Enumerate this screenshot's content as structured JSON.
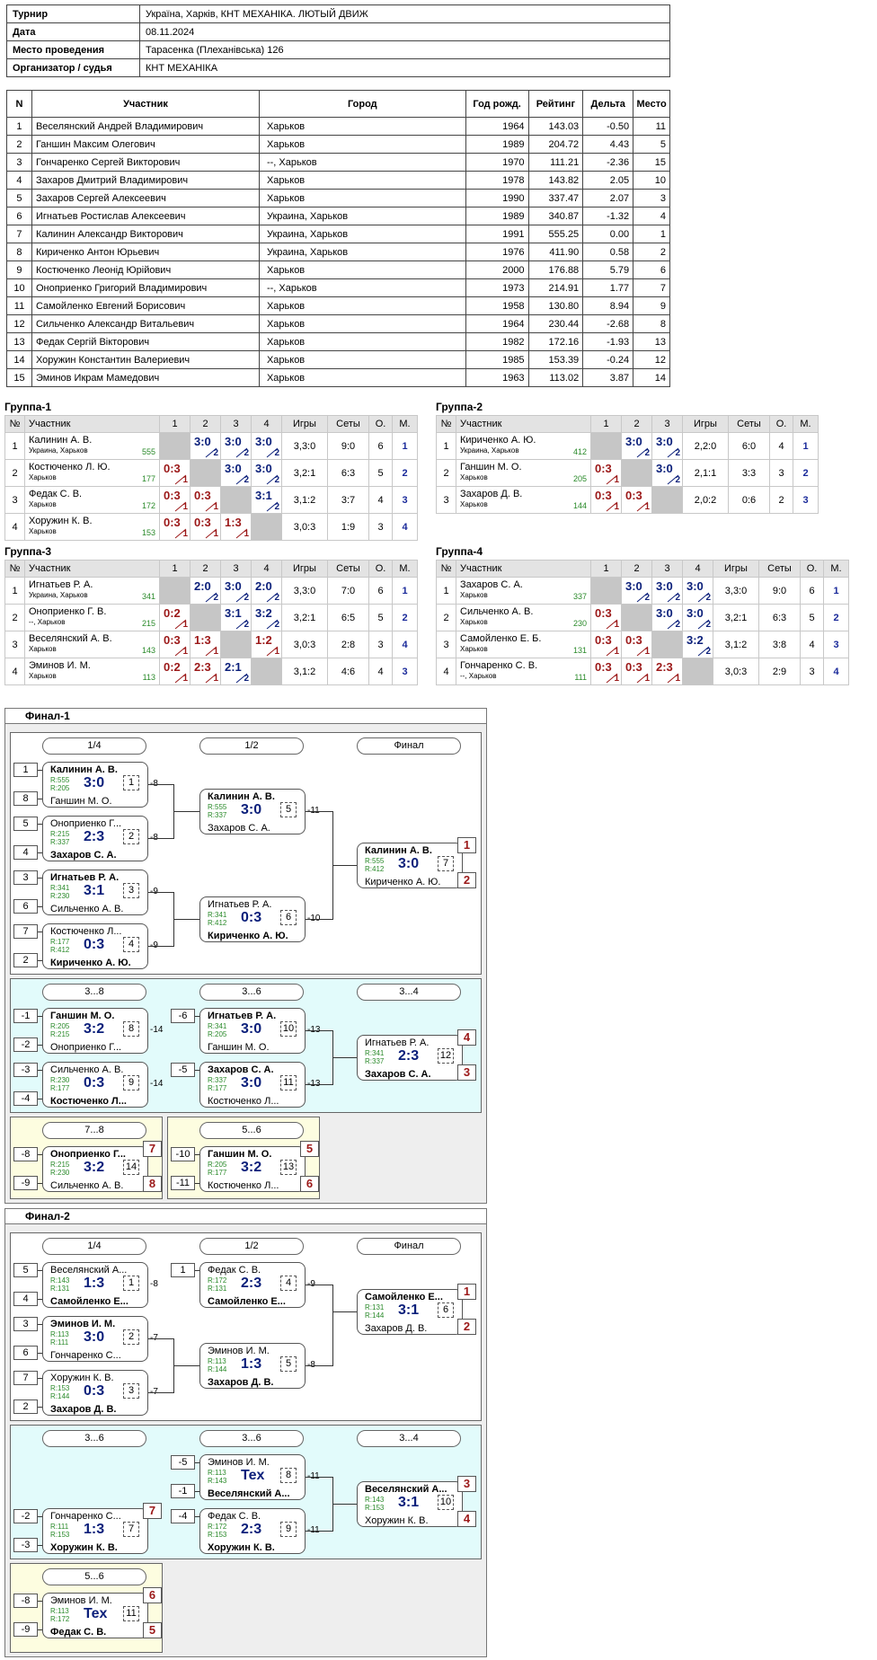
{
  "info": [
    {
      "k": "Турнир",
      "v": "Україна, Харків, КНТ МЕХАНІКА. ЛЮТЫЙ ДВИЖ"
    },
    {
      "k": "Дата",
      "v": "08.11.2024"
    },
    {
      "k": "Место проведения",
      "v": "Тарасенка (Плеханівська) 126"
    },
    {
      "k": "Организатор / судья",
      "v": "КНТ МЕХАНІКА"
    }
  ],
  "players_header": [
    "N",
    "Участник",
    "Город",
    "Год рожд.",
    "Рейтинг",
    "Дельта",
    "Место"
  ],
  "players": [
    [
      "1",
      "Веселянский Андрей Владимирович",
      "Харьков",
      "1964",
      "143.03",
      "-0.50",
      "11"
    ],
    [
      "2",
      "Ганшин Максим Олегович",
      "Харьков",
      "1989",
      "204.72",
      "4.43",
      "5"
    ],
    [
      "3",
      "Гончаренко Сергей Викторович",
      "--, Харьков",
      "1970",
      "111.21",
      "-2.36",
      "15"
    ],
    [
      "4",
      "Захаров Дмитрий Владимирович",
      "Харьков",
      "1978",
      "143.82",
      "2.05",
      "10"
    ],
    [
      "5",
      "Захаров Сергей Алексеевич",
      "Харьков",
      "1990",
      "337.47",
      "2.07",
      "3"
    ],
    [
      "6",
      "Игнатьев Ростислав Алексеевич",
      "Украина, Харьков",
      "1989",
      "340.87",
      "-1.32",
      "4"
    ],
    [
      "7",
      "Калинин Александр Викторович",
      "Украина, Харьков",
      "1991",
      "555.25",
      "0.00",
      "1"
    ],
    [
      "8",
      "Кириченко Антон Юрьевич",
      "Украина, Харьков",
      "1976",
      "411.90",
      "0.58",
      "2"
    ],
    [
      "9",
      "Костюченко Леонід Юрійович",
      "Харьков",
      "2000",
      "176.88",
      "5.79",
      "6"
    ],
    [
      "10",
      "Оноприенко Григорий Владимирович",
      "--, Харьков",
      "1973",
      "214.91",
      "1.77",
      "7"
    ],
    [
      "11",
      "Самойленко Евгений Борисович",
      "Харьков",
      "1958",
      "130.80",
      "8.94",
      "9"
    ],
    [
      "12",
      "Сильченко Александр Витальевич",
      "Харьков",
      "1964",
      "230.44",
      "-2.68",
      "8"
    ],
    [
      "13",
      "Федак Сергій Вікторович",
      "Харьков",
      "1982",
      "172.16",
      "-1.93",
      "13"
    ],
    [
      "14",
      "Хоружин Константин Валериевич",
      "Харьков",
      "1985",
      "153.39",
      "-0.24",
      "12"
    ],
    [
      "15",
      "Эминов Икрам Мамедович",
      "Харьков",
      "1963",
      "113.02",
      "3.87",
      "14"
    ]
  ],
  "group_header": {
    "n": "№",
    "participant": "Участник",
    "games": "Игры",
    "sets": "Сеты",
    "points": "О.",
    "place": "М."
  },
  "groups": [
    {
      "title": "Группа-1",
      "cols": [
        "1",
        "2",
        "3",
        "4"
      ],
      "rows": [
        {
          "n": "1",
          "name": "Калинин А. В.",
          "city": "Украина, Харьков",
          "rating": "555",
          "cells": [
            "",
            "3:0|2",
            "3:0|2",
            "3:0|2"
          ],
          "games": "3,3:0",
          "sets": "9:0",
          "pts": "6",
          "place": "1"
        },
        {
          "n": "2",
          "name": "Костюченко Л. Ю.",
          "city": "Харьков",
          "rating": "177",
          "cells": [
            "0:3|1",
            "",
            "3:0|2",
            "3:0|2"
          ],
          "games": "3,2:1",
          "sets": "6:3",
          "pts": "5",
          "place": "2"
        },
        {
          "n": "3",
          "name": "Федак С. В.",
          "city": "Харьков",
          "rating": "172",
          "cells": [
            "0:3|1",
            "0:3|1",
            "",
            "3:1|2"
          ],
          "games": "3,1:2",
          "sets": "3:7",
          "pts": "4",
          "place": "3"
        },
        {
          "n": "4",
          "name": "Хоружин К. В.",
          "city": "Харьков",
          "rating": "153",
          "cells": [
            "0:3|1",
            "0:3|1",
            "1:3|1",
            ""
          ],
          "games": "3,0:3",
          "sets": "1:9",
          "pts": "3",
          "place": "4"
        }
      ]
    },
    {
      "title": "Группа-2",
      "cols": [
        "1",
        "2",
        "3"
      ],
      "rows": [
        {
          "n": "1",
          "name": "Кириченко А. Ю.",
          "city": "Украина, Харьков",
          "rating": "412",
          "cells": [
            "",
            "3:0|2",
            "3:0|2"
          ],
          "games": "2,2:0",
          "sets": "6:0",
          "pts": "4",
          "place": "1"
        },
        {
          "n": "2",
          "name": "Ганшин М. О.",
          "city": "Харьков",
          "rating": "205",
          "cells": [
            "0:3|1",
            "",
            "3:0|2"
          ],
          "games": "2,1:1",
          "sets": "3:3",
          "pts": "3",
          "place": "2"
        },
        {
          "n": "3",
          "name": "Захаров Д. В.",
          "city": "Харьков",
          "rating": "144",
          "cells": [
            "0:3|1",
            "0:3|1",
            ""
          ],
          "games": "2,0:2",
          "sets": "0:6",
          "pts": "2",
          "place": "3"
        }
      ]
    },
    {
      "title": "Группа-3",
      "cols": [
        "1",
        "2",
        "3",
        "4"
      ],
      "rows": [
        {
          "n": "1",
          "name": "Игнатьев Р. А.",
          "city": "Украина, Харьков",
          "rating": "341",
          "cells": [
            "",
            "2:0|2",
            "3:0|2",
            "2:0|2"
          ],
          "games": "3,3:0",
          "sets": "7:0",
          "pts": "6",
          "place": "1"
        },
        {
          "n": "2",
          "name": "Оноприенко Г. В.",
          "city": "--, Харьков",
          "rating": "215",
          "cells": [
            "0:2|1",
            "",
            "3:1|2",
            "3:2|2"
          ],
          "games": "3,2:1",
          "sets": "6:5",
          "pts": "5",
          "place": "2"
        },
        {
          "n": "3",
          "name": "Веселянский А. В.",
          "city": "Харьков",
          "rating": "143",
          "cells": [
            "0:3|1",
            "1:3|1",
            "",
            "1:2|1"
          ],
          "games": "3,0:3",
          "sets": "2:8",
          "pts": "3",
          "place": "4"
        },
        {
          "n": "4",
          "name": "Эминов И. М.",
          "city": "Харьков",
          "rating": "113",
          "cells": [
            "0:2|1",
            "2:3|1",
            "2:1|2",
            ""
          ],
          "games": "3,1:2",
          "sets": "4:6",
          "pts": "4",
          "place": "3"
        }
      ]
    },
    {
      "title": "Группа-4",
      "cols": [
        "1",
        "2",
        "3",
        "4"
      ],
      "rows": [
        {
          "n": "1",
          "name": "Захаров С. А.",
          "city": "Харьков",
          "rating": "337",
          "cells": [
            "",
            "3:0|2",
            "3:0|2",
            "3:0|2"
          ],
          "games": "3,3:0",
          "sets": "9:0",
          "pts": "6",
          "place": "1"
        },
        {
          "n": "2",
          "name": "Сильченко А. В.",
          "city": "Харьков",
          "rating": "230",
          "cells": [
            "0:3|1",
            "",
            "3:0|2",
            "3:0|2"
          ],
          "games": "3,2:1",
          "sets": "6:3",
          "pts": "5",
          "place": "2"
        },
        {
          "n": "3",
          "name": "Самойленко Е. Б.",
          "city": "Харьков",
          "rating": "131",
          "cells": [
            "0:3|1",
            "0:3|1",
            "",
            "3:2|2"
          ],
          "games": "3,1:2",
          "sets": "3:8",
          "pts": "4",
          "place": "3"
        },
        {
          "n": "4",
          "name": "Гончаренко С. В.",
          "city": "--, Харьков",
          "rating": "111",
          "cells": [
            "0:3|1",
            "0:3|1",
            "2:3|1",
            ""
          ],
          "games": "3,0:3",
          "sets": "2:9",
          "pts": "3",
          "place": "4"
        }
      ]
    }
  ],
  "finals": [
    {
      "title": "Финал-1",
      "sections": [
        {
          "bg": "#ffffff",
          "pills": [
            "1/4",
            "1/2",
            "Финал"
          ]
        },
        {
          "bg": "#e2fbfb",
          "pills": [
            "3...8",
            "3...6",
            "3...4"
          ]
        },
        {
          "bg": "#fdfde0",
          "pills": [
            "7...8"
          ]
        },
        {
          "bg": "#fdfde0",
          "pills": [
            "5...6"
          ]
        }
      ],
      "matches": [
        {
          "p1": "Калинин А. В.",
          "r1": "R:555",
          "p2": "Ганшин М. О.",
          "r2": "R:205",
          "score": "3:0",
          "num": "1",
          "w": 1,
          "seeds": [
            "1",
            "8"
          ],
          "loser": "-8"
        },
        {
          "p1": "Оноприенко Г...",
          "r1": "R:215",
          "p2": "Захаров С. А.",
          "r2": "R:337",
          "score": "2:3",
          "num": "2",
          "w": 2,
          "seeds": [
            "5",
            "4"
          ],
          "loser": "-8"
        },
        {
          "p1": "Игнатьев Р. А.",
          "r1": "R:341",
          "p2": "Сильченко А. В.",
          "r2": "R:230",
          "score": "3:1",
          "num": "3",
          "w": 1,
          "seeds": [
            "3",
            "6"
          ],
          "loser": "-9"
        },
        {
          "p1": "Костюченко Л...",
          "r1": "R:177",
          "p2": "Кириченко А. Ю.",
          "r2": "R:412",
          "score": "0:3",
          "num": "4",
          "w": 2,
          "seeds": [
            "7",
            "2"
          ],
          "loser": "-9"
        },
        {
          "p1": "Калинин А. В.",
          "r1": "R:555",
          "p2": "Захаров С. А.",
          "r2": "R:337",
          "score": "3:0",
          "num": "5",
          "w": 1,
          "loser": "-11"
        },
        {
          "p1": "Игнатьев Р. А.",
          "r1": "R:341",
          "p2": "Кириченко А. Ю.",
          "r2": "R:412",
          "score": "0:3",
          "num": "6",
          "w": 2,
          "loser": "-10"
        },
        {
          "p1": "Калинин А. В.",
          "r1": "R:555",
          "p2": "Кириченко А. Ю.",
          "r2": "R:412",
          "score": "3:0",
          "num": "7",
          "w": 1,
          "places": [
            "1",
            "2"
          ]
        },
        {
          "p1": "Ганшин М. О.",
          "r1": "R:205",
          "p2": "Оноприенко Г...",
          "r2": "R:215",
          "score": "3:2",
          "num": "8",
          "w": 1,
          "seeds": [
            "-1",
            "-2"
          ],
          "loser": "-14"
        },
        {
          "p1": "Сильченко А. В.",
          "r1": "R:230",
          "p2": "Костюченко Л...",
          "r2": "R:177",
          "score": "0:3",
          "num": "9",
          "w": 2,
          "seeds": [
            "-3",
            "-4"
          ],
          "loser": "-14"
        },
        {
          "p1": "Игнатьев Р. А.",
          "r1": "R:341",
          "p2": "Ганшин М. О.",
          "r2": "R:205",
          "score": "3:0",
          "num": "10",
          "w": 1,
          "seeds": [
            "-6"
          ],
          "loser": "-13"
        },
        {
          "p1": "Захаров С. А.",
          "r1": "R:337",
          "p2": "Костюченко Л...",
          "r2": "R:177",
          "score": "3:0",
          "num": "11",
          "w": 1,
          "seeds": [
            "-5"
          ],
          "loser": "-13"
        },
        {
          "p1": "Игнатьев Р. А.",
          "r1": "R:341",
          "p2": "Захаров С. А.",
          "r2": "R:337",
          "score": "2:3",
          "num": "12",
          "w": 2,
          "places": [
            "4",
            "3"
          ]
        },
        {
          "p1": "Оноприенко Г...",
          "r1": "R:215",
          "p2": "Сильченко А. В.",
          "r2": "R:230",
          "score": "3:2",
          "num": "14",
          "w": 1,
          "seeds": [
            "-8",
            "-9"
          ],
          "places": [
            "7",
            "8"
          ]
        },
        {
          "p1": "Ганшин М. О.",
          "r1": "R:205",
          "p2": "Костюченко Л...",
          "r2": "R:177",
          "score": "3:2",
          "num": "13",
          "w": 1,
          "seeds": [
            "-10",
            "-11"
          ],
          "places": [
            "5",
            "6"
          ]
        }
      ]
    },
    {
      "title": "Финал-2",
      "sections": [
        {
          "bg": "#ffffff",
          "pills": [
            "1/4",
            "1/2",
            "Финал"
          ]
        },
        {
          "bg": "#e2fbfb",
          "pills": [
            "3...6",
            "3...6",
            "3...4"
          ]
        },
        {
          "bg": "#fdfde0",
          "pills": [
            "5...6"
          ]
        }
      ],
      "matches": [
        {
          "p1": "Веселянский А...",
          "r1": "R:143",
          "p2": "Самойленко Е...",
          "r2": "R:131",
          "score": "1:3",
          "num": "1",
          "w": 2,
          "seeds": [
            "5",
            "4"
          ],
          "loser": "-8"
        },
        {
          "p1": "Эминов И. М.",
          "r1": "R:113",
          "p2": "Гончаренко С...",
          "r2": "R:111",
          "score": "3:0",
          "num": "2",
          "w": 1,
          "seeds": [
            "3",
            "6"
          ],
          "loser": "-7"
        },
        {
          "p1": "Хоружин К. В.",
          "r1": "R:153",
          "p2": "Захаров Д. В.",
          "r2": "R:144",
          "score": "0:3",
          "num": "3",
          "w": 2,
          "seeds": [
            "7",
            "2"
          ],
          "loser": "-7"
        },
        {
          "p1": "Федак С. В.",
          "r1": "R:172",
          "p2": "Самойленко Е...",
          "r2": "R:131",
          "score": "2:3",
          "num": "4",
          "w": 2,
          "seeds": [
            "1"
          ],
          "loser": "-9"
        },
        {
          "p1": "Эминов И. М.",
          "r1": "R:113",
          "p2": "Захаров Д. В.",
          "r2": "R:144",
          "score": "1:3",
          "num": "5",
          "w": 2,
          "loser": "-8"
        },
        {
          "p1": "Самойленко Е...",
          "r1": "R:131",
          "p2": "Захаров Д. В.",
          "r2": "R:144",
          "score": "3:1",
          "num": "6",
          "w": 1,
          "places": [
            "1",
            "2"
          ]
        },
        {
          "p1": "Гончаренко С...",
          "r1": "R:111",
          "p2": "Хоружин К. В.",
          "r2": "R:153",
          "score": "1:3",
          "num": "7",
          "w": 2,
          "seeds": [
            "-2",
            "-3"
          ],
          "places": [
            "7"
          ]
        },
        {
          "p1": "Эминов И. М.",
          "r1": "R:113",
          "p2": "Веселянский А...",
          "r2": "R:143",
          "score": "Tex",
          "num": "8",
          "w": 2,
          "seeds": [
            "-5",
            "-1"
          ],
          "loser": "-11"
        },
        {
          "p1": "Федак С. В.",
          "r1": "R:172",
          "p2": "Хоружин К. В.",
          "r2": "R:153",
          "score": "2:3",
          "num": "9",
          "w": 2,
          "seeds": [
            "-4"
          ],
          "loser": "-11"
        },
        {
          "p1": "Веселянский А...",
          "r1": "R:143",
          "p2": "Хоружин К. В.",
          "r2": "R:153",
          "score": "3:1",
          "num": "10",
          "w": 1,
          "places": [
            "3",
            "4"
          ]
        },
        {
          "p1": "Эминов И. М.",
          "r1": "R:113",
          "p2": "Федак С. В.",
          "r2": "R:172",
          "score": "Tex",
          "num": "11",
          "w": 2,
          "seeds": [
            "-8",
            "-9"
          ],
          "places": [
            "6",
            "5"
          ]
        }
      ]
    }
  ],
  "colors": {
    "win": "#0b1f7a",
    "lose": "#9b1818",
    "rating": "#2a8a2a",
    "self": "#c6c6c6",
    "header": "#e3e3e3",
    "cyan": "#e2fbfb",
    "yellow": "#fdfde0"
  }
}
